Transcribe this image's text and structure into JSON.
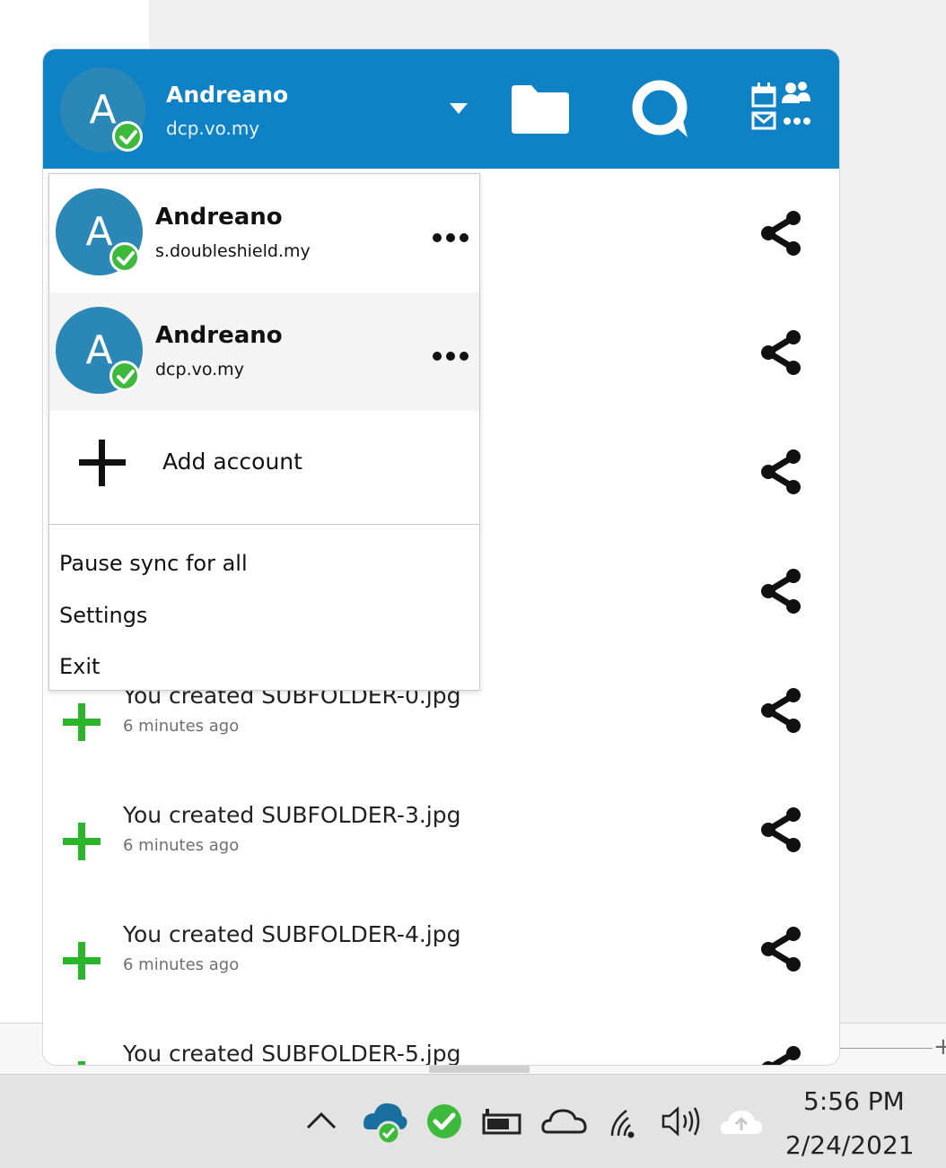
{
  "header": {
    "avatar_letter": "A",
    "account_name": "Andreano",
    "account_domain": "dcp.vo.my",
    "icons": [
      "chevron-down-icon",
      "folder-icon",
      "talk-icon",
      "apps-icon"
    ]
  },
  "dropdown": {
    "accounts": [
      {
        "avatar_letter": "A",
        "name": "Andreano",
        "domain": "s.doubleshield.my"
      },
      {
        "avatar_letter": "A",
        "name": "Andreano",
        "domain": "dcp.vo.my"
      }
    ],
    "add_account_label": "Add account",
    "menu_items": [
      "Pause sync for all",
      "Settings",
      "Exit"
    ]
  },
  "activity": {
    "items": [
      {
        "text": "",
        "time": ""
      },
      {
        "text": "",
        "time": ""
      },
      {
        "text": "",
        "time": ""
      },
      {
        "text": "",
        "time": ""
      },
      {
        "text": "You created SUBFOLDER-0.jpg",
        "time": "6 minutes ago"
      },
      {
        "text": "You created SUBFOLDER-3.jpg",
        "time": "6 minutes ago"
      },
      {
        "text": "You created SUBFOLDER-4.jpg",
        "time": "6 minutes ago"
      },
      {
        "text": "You created SUBFOLDER-5.jpg",
        "time": ""
      }
    ]
  },
  "taskbar": {
    "time": "5:56 PM",
    "date": "2/24/2021"
  },
  "colors": {
    "header_blue": "#0f82c5",
    "avatar_blue": "#2b87b6",
    "status_green": "#3dba3b",
    "plus_green": "#2bb52b"
  }
}
